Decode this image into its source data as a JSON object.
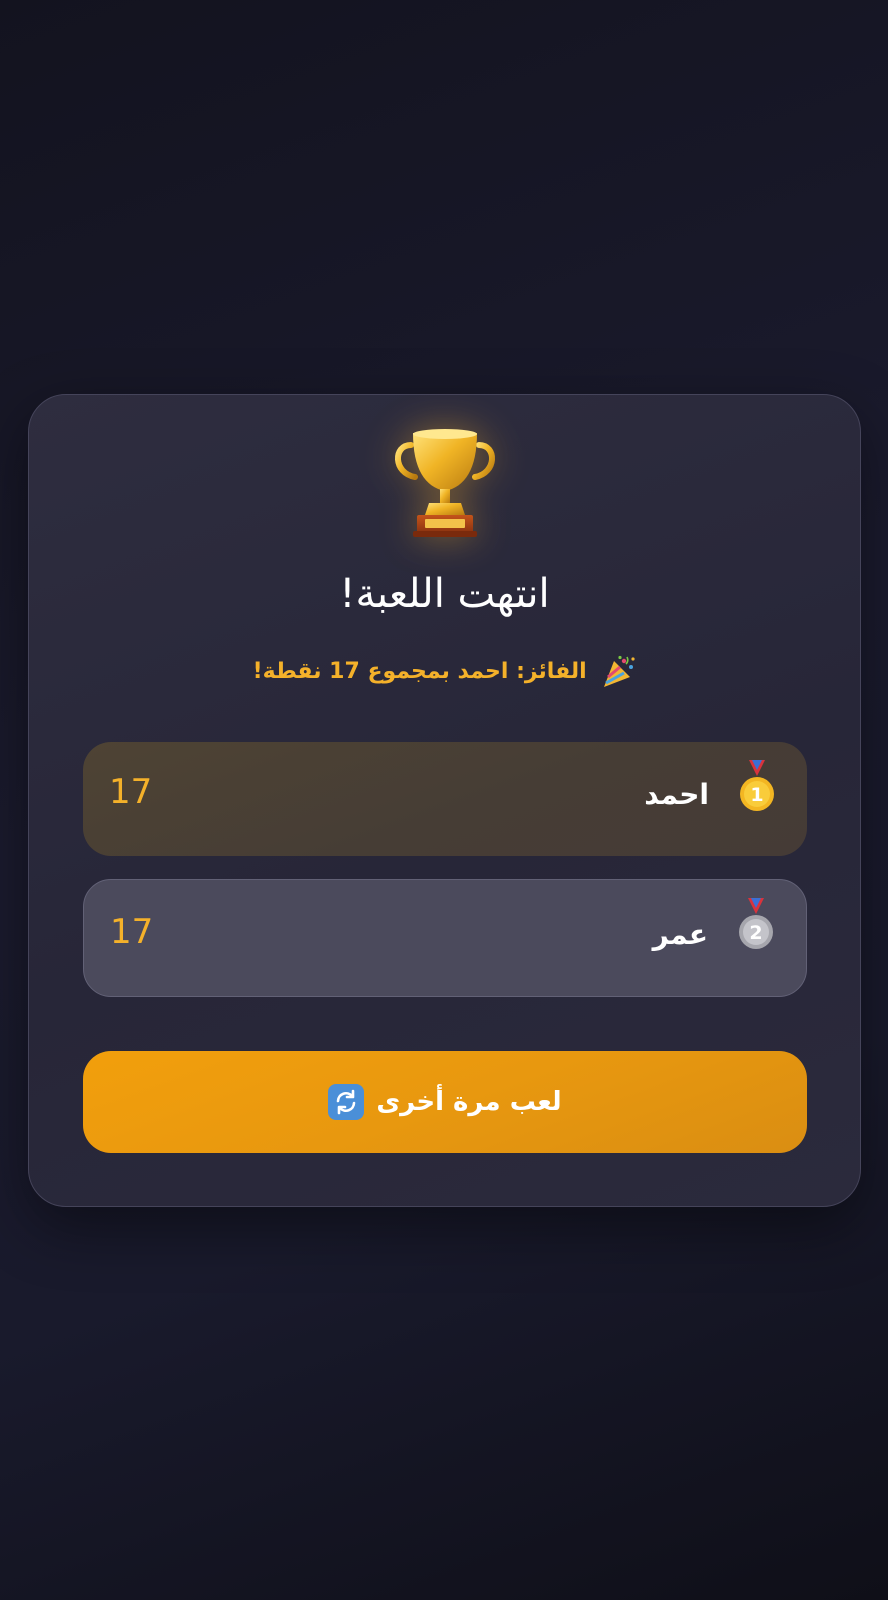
{
  "result": {
    "title": "انتهت اللعبة!",
    "winner_text": "الفائز: احمد بمجموع 17 نقطة!",
    "winner_icon": "party-popper-icon",
    "trophy_icon": "trophy-icon"
  },
  "players": [
    {
      "rank": 1,
      "medal": "gold-medal-icon",
      "medal_number": "1",
      "name": "احمد",
      "score": "17"
    },
    {
      "rank": 2,
      "medal": "silver-medal-icon",
      "medal_number": "2",
      "name": "عمر",
      "score": "17"
    }
  ],
  "actions": {
    "play_again_label": "لعب مرة أخرى",
    "play_again_icon": "refresh-icon"
  },
  "colors": {
    "accent": "#f4b12a",
    "button": "#f29f0c",
    "card": "#2b2a3c",
    "background": "#171726"
  }
}
